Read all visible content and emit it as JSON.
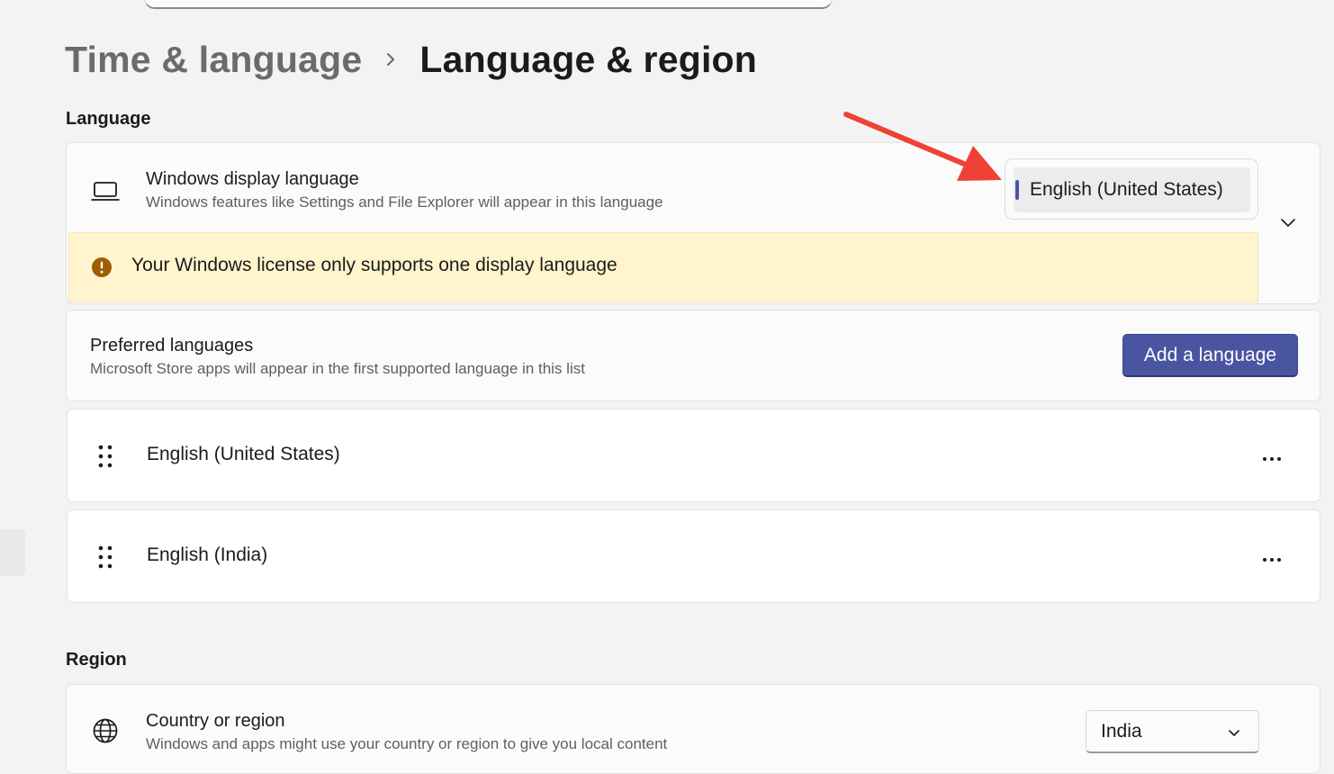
{
  "breadcrumb": {
    "parent": "Time & language",
    "current": "Language & region"
  },
  "language_section": {
    "title": "Language",
    "display_language": {
      "title": "Windows display language",
      "subtitle": "Windows features like Settings and File Explorer will appear in this language",
      "selected_value": "English (United States)",
      "icon": "laptop-icon"
    },
    "license_warning": {
      "text": "Your Windows license only supports one display language",
      "icon": "warning-icon"
    },
    "preferred_languages": {
      "title": "Preferred languages",
      "subtitle": "Microsoft Store apps will appear in the first supported language in this list",
      "add_button_label": "Add a language"
    },
    "languages": [
      {
        "label": "English (United States)"
      },
      {
        "label": "English (India)"
      }
    ]
  },
  "region_section": {
    "title": "Region",
    "country": {
      "title": "Country or region",
      "subtitle": "Windows and apps might use your country or region to give you local content",
      "selected_value": "India",
      "icon": "globe-icon"
    }
  },
  "colors": {
    "accent": "#4a55a2",
    "warning_background": "#fff4ce",
    "warning_icon": "#9d5d00",
    "annotation_arrow": "#ef4136"
  }
}
